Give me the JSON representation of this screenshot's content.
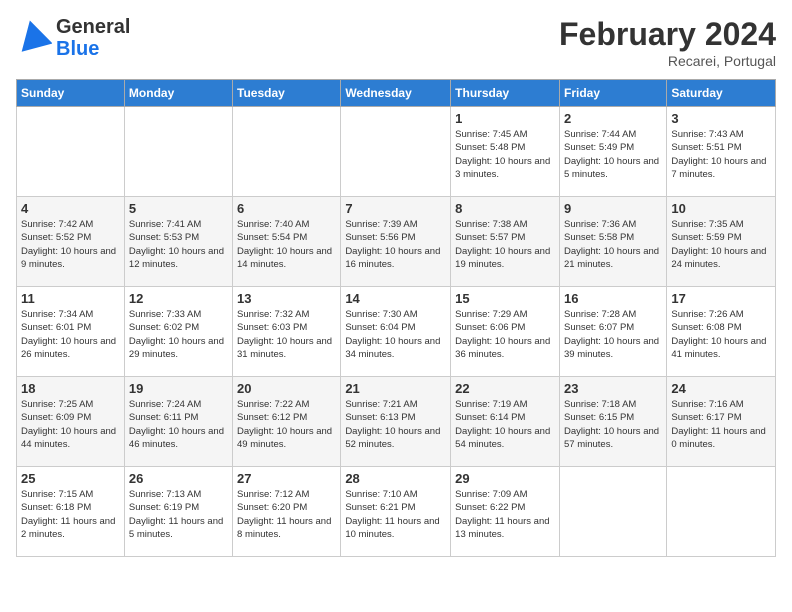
{
  "logo": {
    "line1": "General",
    "line2": "Blue"
  },
  "title": "February 2024",
  "location": "Recarei, Portugal",
  "days_header": [
    "Sunday",
    "Monday",
    "Tuesday",
    "Wednesday",
    "Thursday",
    "Friday",
    "Saturday"
  ],
  "weeks": [
    [
      {
        "day": "",
        "info": ""
      },
      {
        "day": "",
        "info": ""
      },
      {
        "day": "",
        "info": ""
      },
      {
        "day": "",
        "info": ""
      },
      {
        "day": "1",
        "info": "Sunrise: 7:45 AM\nSunset: 5:48 PM\nDaylight: 10 hours and 3 minutes."
      },
      {
        "day": "2",
        "info": "Sunrise: 7:44 AM\nSunset: 5:49 PM\nDaylight: 10 hours and 5 minutes."
      },
      {
        "day": "3",
        "info": "Sunrise: 7:43 AM\nSunset: 5:51 PM\nDaylight: 10 hours and 7 minutes."
      }
    ],
    [
      {
        "day": "4",
        "info": "Sunrise: 7:42 AM\nSunset: 5:52 PM\nDaylight: 10 hours and 9 minutes."
      },
      {
        "day": "5",
        "info": "Sunrise: 7:41 AM\nSunset: 5:53 PM\nDaylight: 10 hours and 12 minutes."
      },
      {
        "day": "6",
        "info": "Sunrise: 7:40 AM\nSunset: 5:54 PM\nDaylight: 10 hours and 14 minutes."
      },
      {
        "day": "7",
        "info": "Sunrise: 7:39 AM\nSunset: 5:56 PM\nDaylight: 10 hours and 16 minutes."
      },
      {
        "day": "8",
        "info": "Sunrise: 7:38 AM\nSunset: 5:57 PM\nDaylight: 10 hours and 19 minutes."
      },
      {
        "day": "9",
        "info": "Sunrise: 7:36 AM\nSunset: 5:58 PM\nDaylight: 10 hours and 21 minutes."
      },
      {
        "day": "10",
        "info": "Sunrise: 7:35 AM\nSunset: 5:59 PM\nDaylight: 10 hours and 24 minutes."
      }
    ],
    [
      {
        "day": "11",
        "info": "Sunrise: 7:34 AM\nSunset: 6:01 PM\nDaylight: 10 hours and 26 minutes."
      },
      {
        "day": "12",
        "info": "Sunrise: 7:33 AM\nSunset: 6:02 PM\nDaylight: 10 hours and 29 minutes."
      },
      {
        "day": "13",
        "info": "Sunrise: 7:32 AM\nSunset: 6:03 PM\nDaylight: 10 hours and 31 minutes."
      },
      {
        "day": "14",
        "info": "Sunrise: 7:30 AM\nSunset: 6:04 PM\nDaylight: 10 hours and 34 minutes."
      },
      {
        "day": "15",
        "info": "Sunrise: 7:29 AM\nSunset: 6:06 PM\nDaylight: 10 hours and 36 minutes."
      },
      {
        "day": "16",
        "info": "Sunrise: 7:28 AM\nSunset: 6:07 PM\nDaylight: 10 hours and 39 minutes."
      },
      {
        "day": "17",
        "info": "Sunrise: 7:26 AM\nSunset: 6:08 PM\nDaylight: 10 hours and 41 minutes."
      }
    ],
    [
      {
        "day": "18",
        "info": "Sunrise: 7:25 AM\nSunset: 6:09 PM\nDaylight: 10 hours and 44 minutes."
      },
      {
        "day": "19",
        "info": "Sunrise: 7:24 AM\nSunset: 6:11 PM\nDaylight: 10 hours and 46 minutes."
      },
      {
        "day": "20",
        "info": "Sunrise: 7:22 AM\nSunset: 6:12 PM\nDaylight: 10 hours and 49 minutes."
      },
      {
        "day": "21",
        "info": "Sunrise: 7:21 AM\nSunset: 6:13 PM\nDaylight: 10 hours and 52 minutes."
      },
      {
        "day": "22",
        "info": "Sunrise: 7:19 AM\nSunset: 6:14 PM\nDaylight: 10 hours and 54 minutes."
      },
      {
        "day": "23",
        "info": "Sunrise: 7:18 AM\nSunset: 6:15 PM\nDaylight: 10 hours and 57 minutes."
      },
      {
        "day": "24",
        "info": "Sunrise: 7:16 AM\nSunset: 6:17 PM\nDaylight: 11 hours and 0 minutes."
      }
    ],
    [
      {
        "day": "25",
        "info": "Sunrise: 7:15 AM\nSunset: 6:18 PM\nDaylight: 11 hours and 2 minutes."
      },
      {
        "day": "26",
        "info": "Sunrise: 7:13 AM\nSunset: 6:19 PM\nDaylight: 11 hours and 5 minutes."
      },
      {
        "day": "27",
        "info": "Sunrise: 7:12 AM\nSunset: 6:20 PM\nDaylight: 11 hours and 8 minutes."
      },
      {
        "day": "28",
        "info": "Sunrise: 7:10 AM\nSunset: 6:21 PM\nDaylight: 11 hours and 10 minutes."
      },
      {
        "day": "29",
        "info": "Sunrise: 7:09 AM\nSunset: 6:22 PM\nDaylight: 11 hours and 13 minutes."
      },
      {
        "day": "",
        "info": ""
      },
      {
        "day": "",
        "info": ""
      }
    ]
  ]
}
